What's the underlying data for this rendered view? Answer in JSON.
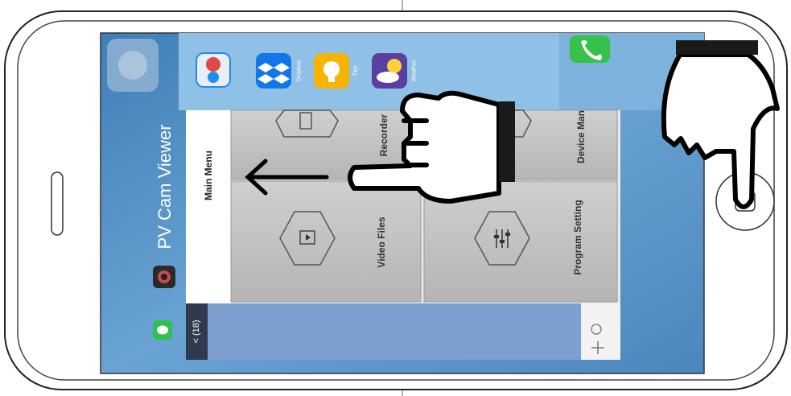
{
  "app_switcher": {
    "title": "PV Cam Viewer",
    "dock_apps": [
      {
        "icon": "app-store-icon",
        "label": "",
        "color": "#1f8dee"
      },
      {
        "icon": "dropbox-icon",
        "label": "Dropbox",
        "color": "#1276e8"
      },
      {
        "icon": "tips-icon",
        "label": "Tips",
        "color": "#f6b400"
      },
      {
        "icon": "weather-icon",
        "label": "Weather",
        "color": "#5a3ea0"
      },
      {
        "icon": "phone-icon",
        "label": "",
        "color": "#35c14a"
      }
    ]
  },
  "main_menu": {
    "header": "Main Menu",
    "items": [
      {
        "label": "Recorder",
        "icon": "recorder-icon"
      },
      {
        "label": "Device Man",
        "icon": "device-icon"
      },
      {
        "label": "Video Files",
        "icon": "video-files-icon"
      },
      {
        "label": "Program Setting",
        "icon": "settings-sliders-icon"
      }
    ]
  },
  "messages_card": {
    "back_label": "< (18)",
    "emoji_icon": "smiley-icon",
    "add_icon": "plus-icon"
  },
  "gesture": {
    "swipe_direction": "left",
    "icons": [
      "hand-swipe-icon",
      "hand-press-icon",
      "arrow-left-icon"
    ]
  },
  "colors": {
    "wallpaper": "#5d95c7",
    "menu_tile": "#c2c2c2",
    "card_header": "#2f3a4e"
  }
}
